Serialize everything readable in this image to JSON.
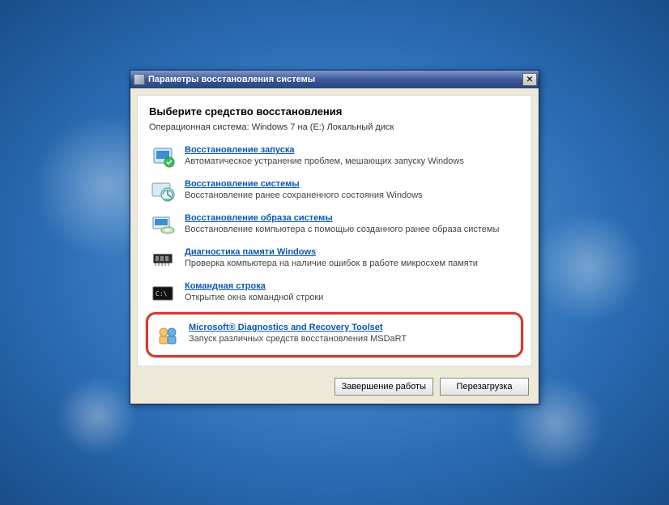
{
  "window": {
    "title": "Параметры восстановления системы",
    "close_label": "✕"
  },
  "heading": "Выберите средство восстановления",
  "os_label": "Операционная система:",
  "os_value": "Windows 7 на (E:) Локальный диск",
  "options": [
    {
      "title": "Восстановление запуска",
      "desc": "Автоматическое устранение проблем, мешающих запуску Windows"
    },
    {
      "title": "Восстановление системы",
      "desc": "Восстановление ранее сохраненного состояния Windows"
    },
    {
      "title": "Восстановление образа системы",
      "desc": "Восстановление компьютера с помощью  созданного ранее образа системы"
    },
    {
      "title": "Диагностика памяти Windows",
      "desc": "Проверка компьютера на наличие ошибок в работе микросхем памяти"
    },
    {
      "title": "Командная строка",
      "desc": "Открытие окна командной строки"
    },
    {
      "title": "Microsoft® Diagnostics and Recovery Toolset",
      "desc": "Запуск различных средств восстановления MSDaRT"
    }
  ],
  "buttons": {
    "shutdown": "Завершение работы",
    "restart": "Перезагрузка"
  }
}
